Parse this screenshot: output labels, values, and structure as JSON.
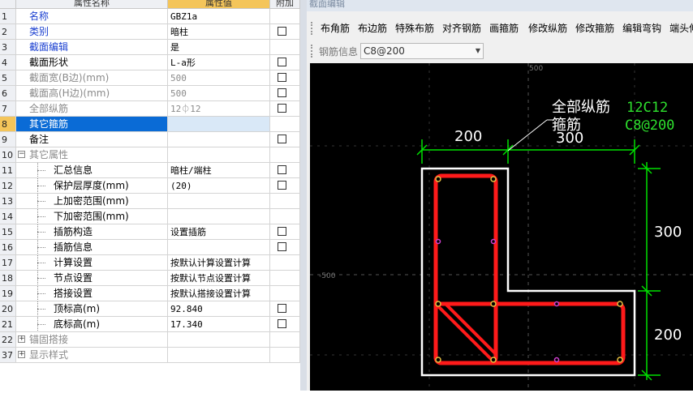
{
  "grid": {
    "headers": {
      "name": "属性名称",
      "value": "属性值",
      "add": "附加"
    },
    "rows": [
      {
        "num": "1",
        "name": "名称",
        "value": "GBZ1a",
        "style": "blue",
        "indent": 1,
        "check": false,
        "selected": false
      },
      {
        "num": "2",
        "name": "类别",
        "value": "暗柱",
        "style": "blue",
        "indent": 1,
        "check": true,
        "selected": false
      },
      {
        "num": "3",
        "name": "截面编辑",
        "value": "是",
        "style": "blue",
        "indent": 1,
        "check": false,
        "selected": false
      },
      {
        "num": "4",
        "name": "截面形状",
        "value": "L-a形",
        "style": "normal",
        "indent": 1,
        "check": true,
        "selected": false
      },
      {
        "num": "5",
        "name": "截面宽(B边)(mm)",
        "value": "500",
        "style": "gray",
        "indent": 1,
        "check": true,
        "selected": false
      },
      {
        "num": "6",
        "name": "截面高(H边)(mm)",
        "value": "500",
        "style": "gray",
        "indent": 1,
        "check": true,
        "selected": false
      },
      {
        "num": "7",
        "name": "全部纵筋",
        "value": "12⏀12",
        "style": "gray",
        "indent": 1,
        "check": true,
        "selected": false
      },
      {
        "num": "8",
        "name": "其它箍筋",
        "value": "",
        "style": "normal",
        "indent": 1,
        "check": false,
        "selected": true
      },
      {
        "num": "9",
        "name": "备注",
        "value": "",
        "style": "normal",
        "indent": 1,
        "check": true,
        "selected": false
      },
      {
        "num": "10",
        "name": "其它属性",
        "value": "",
        "style": "gray",
        "indent": 0,
        "toggle": "−",
        "check": false,
        "selected": false
      },
      {
        "num": "11",
        "name": "汇总信息",
        "value": "暗柱/端柱",
        "style": "normal",
        "indent": 2,
        "check": true,
        "selected": false
      },
      {
        "num": "12",
        "name": "保护层厚度(mm)",
        "value": "(20)",
        "style": "normal",
        "indent": 2,
        "check": true,
        "selected": false
      },
      {
        "num": "13",
        "name": "上加密范围(mm)",
        "value": "",
        "style": "normal",
        "indent": 2,
        "check": false,
        "selected": false
      },
      {
        "num": "14",
        "name": "下加密范围(mm)",
        "value": "",
        "style": "normal",
        "indent": 2,
        "check": false,
        "selected": false
      },
      {
        "num": "15",
        "name": "插筋构造",
        "value": "设置插筋",
        "style": "normal",
        "indent": 2,
        "check": true,
        "selected": false
      },
      {
        "num": "16",
        "name": "插筋信息",
        "value": "",
        "style": "normal",
        "indent": 2,
        "check": true,
        "selected": false
      },
      {
        "num": "17",
        "name": "计算设置",
        "value": "按默认计算设置计算",
        "style": "normal",
        "indent": 2,
        "check": false,
        "selected": false
      },
      {
        "num": "18",
        "name": "节点设置",
        "value": "按默认节点设置计算",
        "style": "normal",
        "indent": 2,
        "check": false,
        "selected": false
      },
      {
        "num": "19",
        "name": "搭接设置",
        "value": "按默认搭接设置计算",
        "style": "normal",
        "indent": 2,
        "check": false,
        "selected": false
      },
      {
        "num": "20",
        "name": "顶标高(m)",
        "value": "92.840",
        "style": "normal",
        "indent": 2,
        "check": true,
        "selected": false
      },
      {
        "num": "21",
        "name": "底标高(m)",
        "value": "17.340",
        "style": "normal",
        "indent": 2,
        "check": true,
        "selected": false
      },
      {
        "num": "22",
        "name": "锚固搭接",
        "value": "",
        "style": "gray",
        "indent": 0,
        "toggle": "+",
        "check": false,
        "selected": false
      },
      {
        "num": "37",
        "name": "显示样式",
        "value": "",
        "style": "gray",
        "indent": 0,
        "toggle": "+",
        "check": false,
        "selected": false
      }
    ]
  },
  "editor": {
    "title": "截面编辑",
    "toolbar": [
      "布角筋",
      "布边筋",
      "特殊布筋",
      "对齐钢筋",
      "画箍筋",
      "修改纵筋",
      "修改箍筋",
      "编辑弯钩",
      "端头伸"
    ],
    "rebar_info_label": "钢筋信息",
    "rebar_info_value": "C8@200"
  },
  "drawing": {
    "dims": {
      "top_left": "200",
      "top_right": "300",
      "right_top": "300",
      "right_bottom": "200"
    },
    "axis_labels": {
      "top": "500",
      "left": "-500"
    },
    "leader_labels": {
      "all_bars": "全部纵筋",
      "stirrup": "箍筋"
    },
    "green_labels": {
      "bars": "12C12",
      "stirrup": "C8@200"
    },
    "colors": {
      "background": "#000000",
      "section": "#ffffff",
      "stirrup": "#ff1a1a",
      "dimension": "#00e000",
      "label": "#ffffff",
      "bar": "#e8c040",
      "mid_point": "#d040d0"
    }
  }
}
